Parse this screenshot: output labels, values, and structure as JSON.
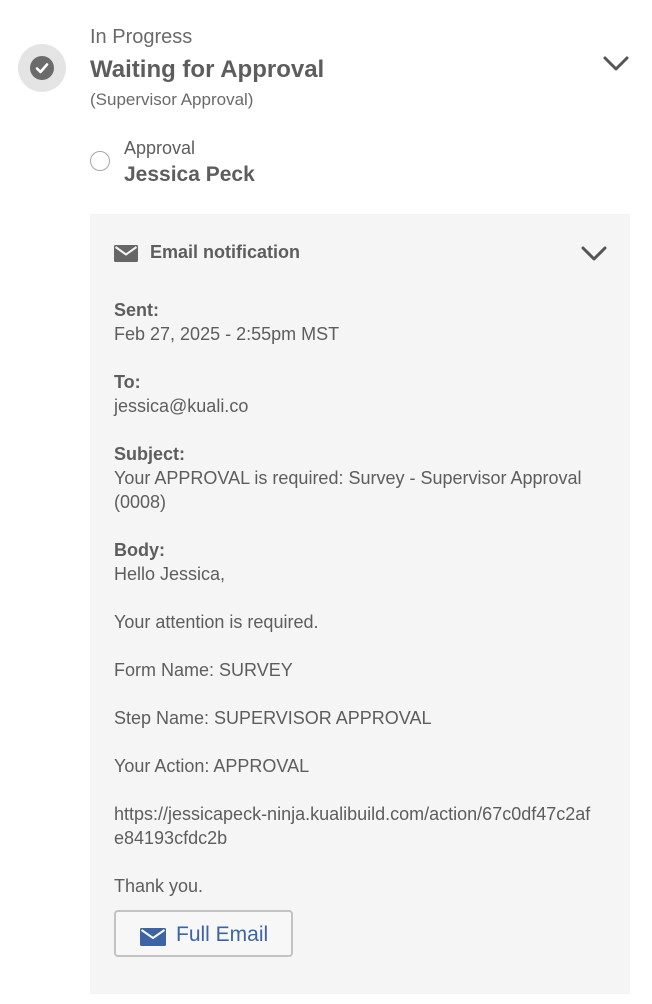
{
  "step": {
    "status": "In Progress",
    "title": "Waiting for Approval",
    "subtitle": "(Supervisor Approval)",
    "icon": "check-circle-icon",
    "expand_icon": "chevron-down-icon"
  },
  "approver": {
    "label": "Approval",
    "name": "Jessica Peck"
  },
  "notification": {
    "icon": "envelope-icon",
    "title": "Email notification",
    "expand_icon": "chevron-down-icon",
    "sent_label": "Sent:",
    "sent_value": "Feb 27, 2025 - 2:55pm MST",
    "to_label": "To:",
    "to_value": "jessica@kuali.co",
    "subject_label": "Subject:",
    "subject_value": "Your APPROVAL is required: Survey - Supervisor Approval (0008)",
    "body_label": "Body:",
    "body_lines": [
      "Hello Jessica,",
      "Your attention is required.",
      "Form Name: SURVEY",
      "Step Name: SUPERVISOR APPROVAL",
      "Your Action: APPROVAL",
      "https://jessicapeck-ninja.kualibuild.com/action/67c0df47c2afe84193cfdc2b",
      "Thank you."
    ],
    "full_email_label": "Full Email"
  },
  "colors": {
    "accent": "#3c64a4",
    "panel_background": "#f5f5f5",
    "text": "#5d5d5d",
    "icon_gray": "#6b6b6b"
  }
}
